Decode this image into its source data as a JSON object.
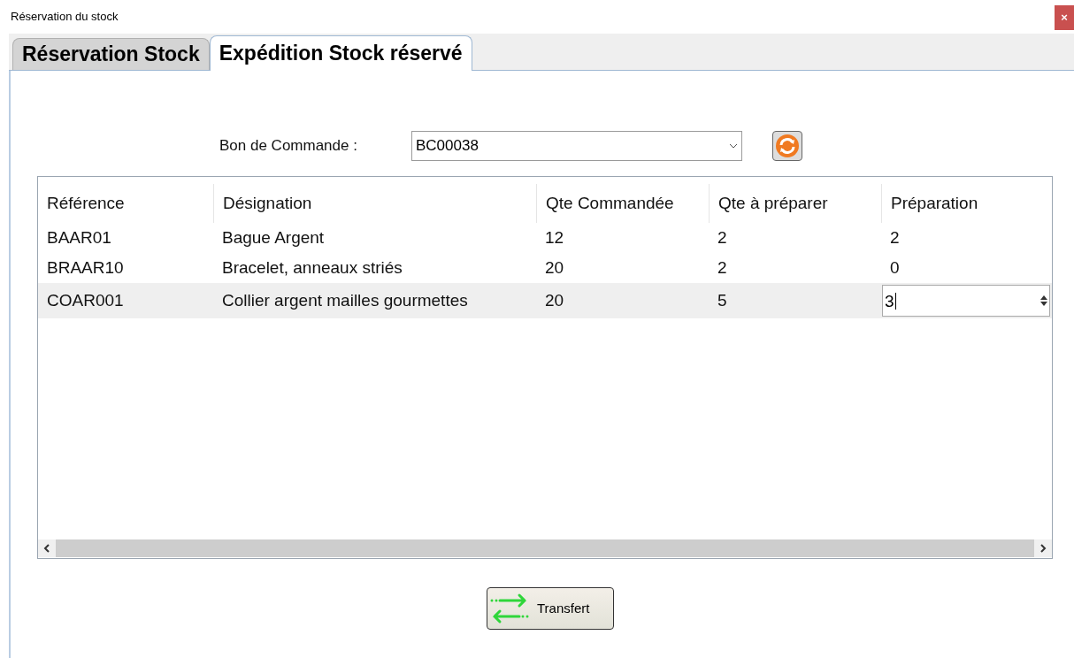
{
  "window": {
    "title": "Réservation du stock",
    "close": "×"
  },
  "tabs": [
    {
      "label": "Réservation Stock",
      "selected": false
    },
    {
      "label": "Expédition Stock réservé",
      "selected": true
    }
  ],
  "order": {
    "label": "Bon de Commande :",
    "value": "BC00038"
  },
  "table": {
    "columns": [
      "Référence",
      "Désignation",
      "Qte Commandée",
      "Qte à préparer",
      "Préparation"
    ],
    "rows": [
      {
        "cells": [
          "BAAR01",
          "Bague Argent",
          "12",
          "2",
          "2"
        ],
        "selected": false,
        "editing": false
      },
      {
        "cells": [
          "BRAAR10",
          "Bracelet, anneaux striés",
          "20",
          "2",
          "0"
        ],
        "selected": false,
        "editing": false
      },
      {
        "cells": [
          "COAR001",
          "Collier argent mailles gourmettes",
          "20",
          "5",
          "3"
        ],
        "selected": true,
        "editing": true
      }
    ]
  },
  "buttons": [
    {
      "label": "Transfert"
    }
  ]
}
